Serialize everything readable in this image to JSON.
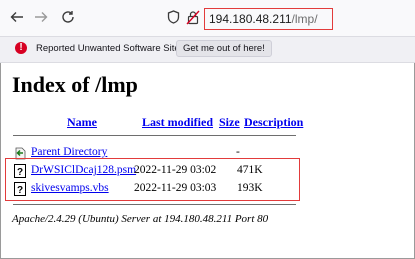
{
  "browser": {
    "url_host": "194.180.48.211",
    "url_path": "/lmp/"
  },
  "warning_bar": {
    "message": "Reported Unwanted Software Site!",
    "button_label": "Get me out of here!",
    "icon": "warning-circle-icon"
  },
  "listing": {
    "title": "Index of /lmp",
    "columns": {
      "name": "Name",
      "last_modified": "Last modified",
      "size": "Size",
      "description": "Description"
    },
    "parent": {
      "name": "Parent Directory",
      "size": "-"
    },
    "files": [
      {
        "name": "DrWSIClDcaj128.psm",
        "modified": "2022-11-29 03:02",
        "size": "471K"
      },
      {
        "name": "skivesvamps.vbs",
        "modified": "2022-11-29 03:03",
        "size": "193K"
      }
    ],
    "address": "Apache/2.4.29 (Ubuntu) Server at 194.180.48.211 Port 80"
  },
  "colors": {
    "link": "#0000ee",
    "highlight": "#e23b3b",
    "warning": "#d70022"
  }
}
